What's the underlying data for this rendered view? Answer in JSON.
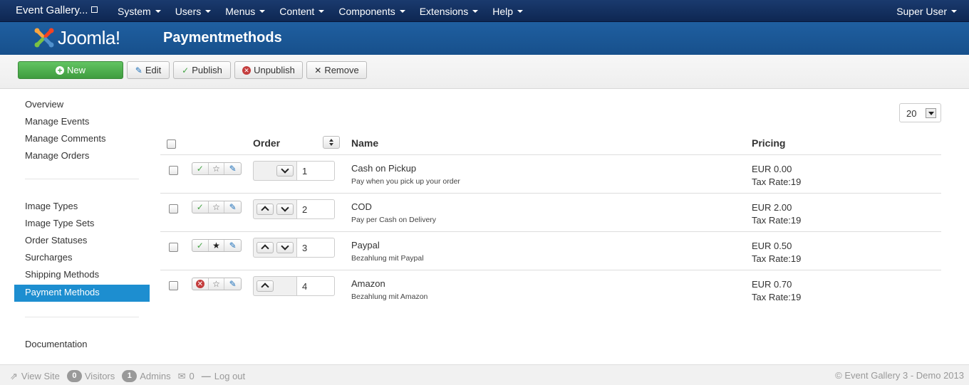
{
  "navbar": {
    "brand": "Event Gallery...",
    "menu": [
      "System",
      "Users",
      "Menus",
      "Content",
      "Components",
      "Extensions",
      "Help"
    ],
    "user": "Super User"
  },
  "header": {
    "logo_text": "Joomla!",
    "title": "Paymentmethods"
  },
  "toolbar": {
    "new_label": "New",
    "edit_label": "Edit",
    "publish_label": "Publish",
    "unpublish_label": "Unpublish",
    "remove_label": "Remove"
  },
  "sidebar": {
    "group1": [
      "Overview",
      "Manage Events",
      "Manage Comments",
      "Manage Orders"
    ],
    "group2": [
      "Image Types",
      "Image Type Sets",
      "Order Statuses",
      "Surcharges",
      "Shipping Methods",
      "Payment Methods"
    ],
    "group3": [
      "Documentation"
    ],
    "active": "Payment Methods"
  },
  "list_limit": "20",
  "table": {
    "columns": {
      "order": "Order",
      "name": "Name",
      "pricing": "Pricing"
    },
    "rows": [
      {
        "published": true,
        "default": false,
        "order": "1",
        "name": "Cash on Pickup",
        "description": "Pay when you pick up your order",
        "price": "EUR 0.00",
        "tax": "Tax Rate:19"
      },
      {
        "published": true,
        "default": false,
        "order": "2",
        "name": "COD",
        "description": "Pay per Cash on Delivery",
        "price": "EUR 2.00",
        "tax": "Tax Rate:19"
      },
      {
        "published": true,
        "default": true,
        "order": "3",
        "name": "Paypal",
        "description": "Bezahlung mit Paypal",
        "price": "EUR 0.50",
        "tax": "Tax Rate:19"
      },
      {
        "published": false,
        "default": false,
        "order": "4",
        "name": "Amazon",
        "description": "Bezahlung mit Amazon",
        "price": "EUR 0.70",
        "tax": "Tax Rate:19"
      }
    ]
  },
  "footer": {
    "view_site": "View Site",
    "visitors_count": "0",
    "visitors_label": "Visitors",
    "admins_count": "1",
    "admins_label": "Admins",
    "messages_count": "0",
    "logout": "Log out",
    "copyright": "© Event Gallery 3 - Demo 2013"
  }
}
